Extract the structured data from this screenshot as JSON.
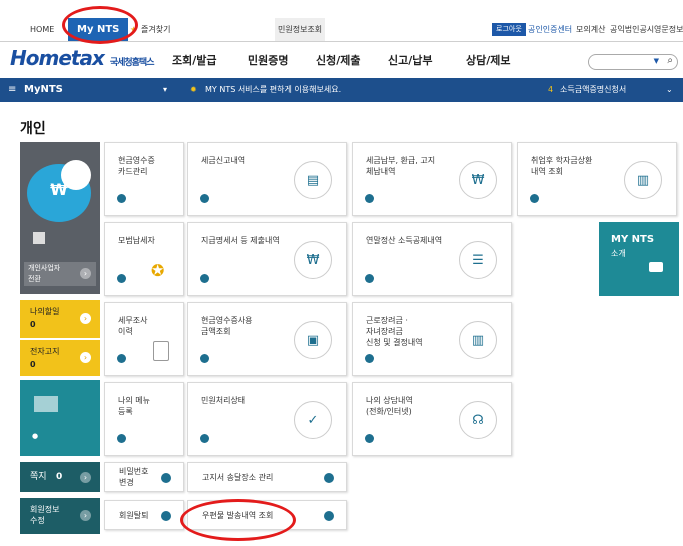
{
  "topbar": {
    "home": "HOME",
    "mynts": "My NTS",
    "favorites": "즐겨찾기",
    "info": "민원정보조회",
    "login": "로그아웃",
    "cert": "공인인증센터",
    "mock": "모의계산",
    "corp": "공익법인공시",
    "ombud": "영문정보"
  },
  "nav": {
    "logo": "Hometax",
    "logo_sub": "국세청홈택스",
    "menus": [
      "조회/발급",
      "민원증명",
      "신청/제출",
      "신고/납부",
      "상담/제보"
    ]
  },
  "bluebar": {
    "title": "MyNTS",
    "notice": "MY NTS 서비스를 편하게 이용해보세요.",
    "promo": "소득금액증명신청서"
  },
  "section_title": "개인",
  "profile": {
    "biz_switch": "개인사업자\n전환"
  },
  "side": {
    "my_tax": "나의할일",
    "my_tax_count": "0",
    "notice": "전자고지",
    "notice_count": "0",
    "note": "쪽지",
    "note_count": "0",
    "member": "회원정보\n수정"
  },
  "tiles": {
    "t1": "현금영수증\n카드관리",
    "t2": "세금신고내역",
    "t3": "세금납부, 환급, 고지\n체납내역",
    "t4": "취업후 학자금상환\n내역 조회",
    "t5": "모범납세자",
    "t6": "지급명세서 등 제출내역",
    "t7": "연말정산 소득공제내역",
    "t8": "세무조사\n이력",
    "t9": "현금영수증사용\n금액조회",
    "t10": "근로장려금 ·\n자녀장려금\n신청 및 결정내역",
    "t11": "나의 메뉴\n등록",
    "t12": "민원처리상태",
    "t13": "나의 상담내역\n(전화/인터넷)",
    "t14": "비밀번호\n변경",
    "t15": "고지서 송달장소 관리",
    "t16": "회원탈퇴",
    "t17": "우편물 발송내역 조회"
  },
  "mynts_intro": {
    "title": "MY NTS",
    "sub": "소개"
  },
  "colors": {
    "teal": "#1e8a96",
    "yellow": "#f2c21a",
    "navy": "#1d4f8c",
    "accent": "#1e64b4"
  }
}
